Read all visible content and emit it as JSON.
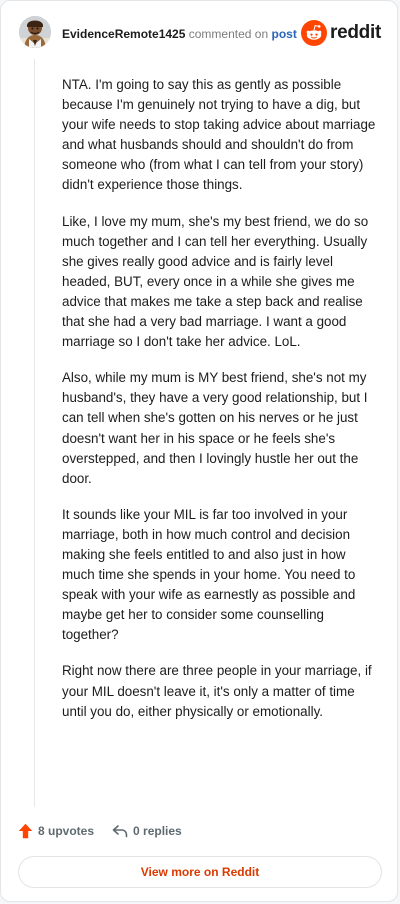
{
  "header": {
    "author": "EvidenceRemote1425",
    "commented_on": "commented on",
    "post_link": "post",
    "brand": "reddit"
  },
  "comment": {
    "paragraphs": [
      "NTA. I'm going to say this as gently as possible because I'm genuinely not trying to have a dig, but your wife needs to stop taking advice about marriage and what husbands should and shouldn't do from someone who (from what I can tell from your story) didn't experience those things.",
      "Like, I love my mum, she's my best friend, we do so much together and I can tell her everything. Usually she gives really good advice and is fairly level headed, BUT, every once in a while she gives me advice that makes me take a step back and realise that she had a very bad marriage. I want a good marriage so I don't take her advice. LoL.",
      "Also, while my mum is MY best friend, she's not my husband's, they have a very good relationship, but I can tell when she's gotten on his nerves or he just doesn't want her in his space or he feels she's overstepped, and then I lovingly hustle her out the door.",
      "It sounds like your MIL is far too involved in your marriage, both in how much control and decision making she feels entitled to and also just in how much time she spends in your home. You need to speak with your wife as earnestly as possible and maybe get her to consider some counselling together?",
      "Right now there are three people in your marriage, if your MIL doesn't leave it, it's only a matter of time until you do, either physically or emotionally."
    ]
  },
  "actions": {
    "upvotes": "8 upvotes",
    "replies": "0 replies"
  },
  "footer": {
    "view_more": "View more on Reddit"
  },
  "icons": {
    "avatar": "avatar-icon",
    "reddit": "reddit-snoo-icon",
    "upvote": "upvote-arrow-icon",
    "reply": "reply-arrow-icon"
  },
  "colors": {
    "brand_orange": "#ff4500",
    "link_blue": "#2a65b8",
    "view_more_text": "#d93a00",
    "upvote_arrow": "#ff4500"
  }
}
